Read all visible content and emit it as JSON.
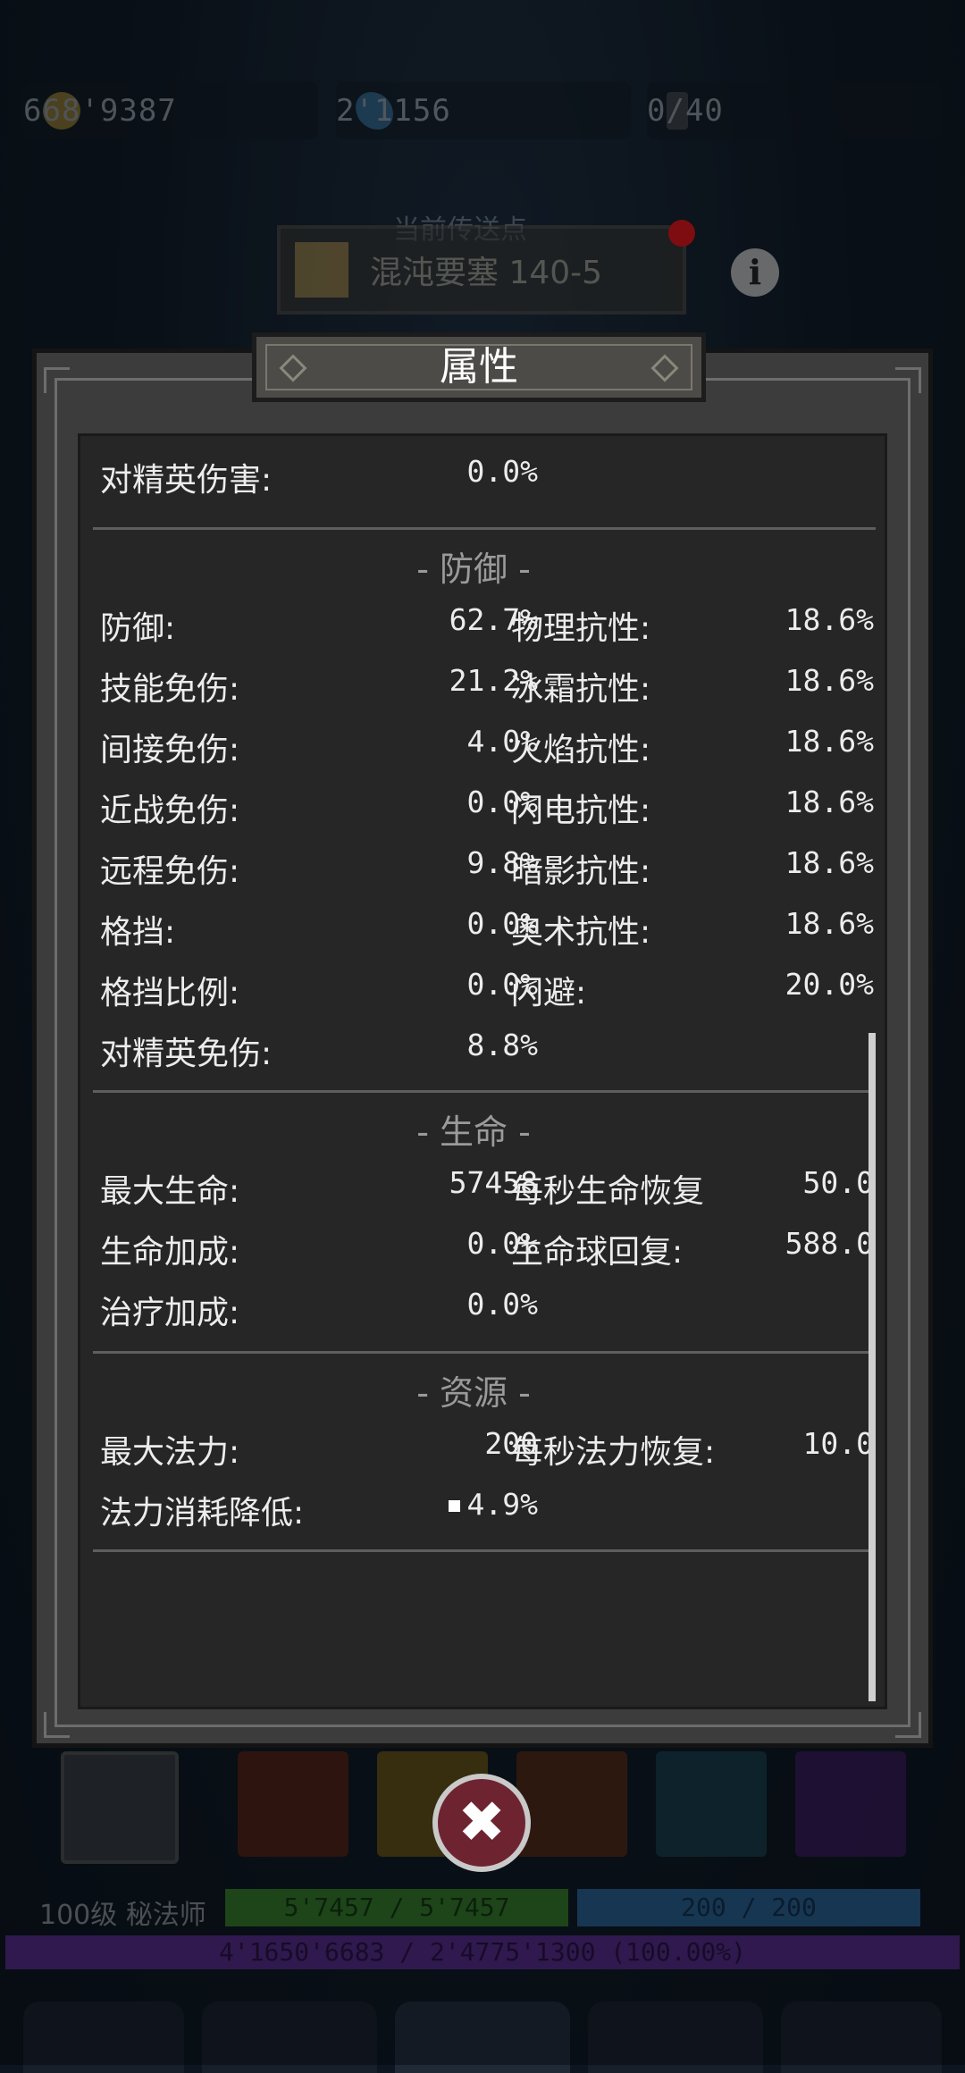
{
  "resources": {
    "gold": "668'9387",
    "gems": "2'1156",
    "keys": "0/40"
  },
  "teleport": {
    "label": "当前传送点",
    "name": "混沌要塞 140-5"
  },
  "panel": {
    "title": "属性",
    "top_row": {
      "label": "对精英伤害:",
      "value": "0.0%"
    },
    "sections": {
      "defense": {
        "title": "- 防御 -",
        "left": [
          {
            "label": "防御:",
            "value": "62.7%"
          },
          {
            "label": "技能免伤:",
            "value": "21.2%"
          },
          {
            "label": "间接免伤:",
            "value": "4.0%"
          },
          {
            "label": "近战免伤:",
            "value": "0.0%"
          },
          {
            "label": "远程免伤:",
            "value": "9.8%"
          },
          {
            "label": "格挡:",
            "value": "0.0%"
          },
          {
            "label": "格挡比例:",
            "value": "0.0%"
          },
          {
            "label": "对精英免伤:",
            "value": "8.8%"
          }
        ],
        "right": [
          {
            "label": "物理抗性:",
            "value": "18.6%"
          },
          {
            "label": "冰霜抗性:",
            "value": "18.6%"
          },
          {
            "label": "火焰抗性:",
            "value": "18.6%"
          },
          {
            "label": "闪电抗性:",
            "value": "18.6%"
          },
          {
            "label": "暗影抗性:",
            "value": "18.6%"
          },
          {
            "label": "奥术抗性:",
            "value": "18.6%"
          },
          {
            "label": "闪避:",
            "value": "20.0%"
          }
        ]
      },
      "life": {
        "title": "- 生命 -",
        "left": [
          {
            "label": "最大生命:",
            "value": "57458"
          },
          {
            "label": "生命加成:",
            "value": "0.0%"
          },
          {
            "label": "治疗加成:",
            "value": "0.0%"
          }
        ],
        "right": [
          {
            "label": "每秒生命恢复",
            "value": "50.0"
          },
          {
            "label": "生命球回复:",
            "value": "588.0"
          }
        ]
      },
      "resource": {
        "title": "- 资源 -",
        "left": [
          {
            "label": "最大法力:",
            "value": "200"
          },
          {
            "label": "法力消耗降低:",
            "value": "4.9%"
          }
        ],
        "right": [
          {
            "label": "每秒法力恢复:",
            "value": "10.0"
          }
        ]
      }
    }
  },
  "player": {
    "level_class": "100级 秘法师",
    "hp": "5'7457 / 5'7457",
    "mp": "200 / 200",
    "xp": "4'1650'6683 / 2'4775'1300 (100.00%)"
  },
  "colors": {
    "accent_close": "#6e2430",
    "panel_bg": "#262626",
    "hp": "#3c8f2a",
    "mp": "#2f6fa8",
    "xp": "#5a2c8f"
  }
}
